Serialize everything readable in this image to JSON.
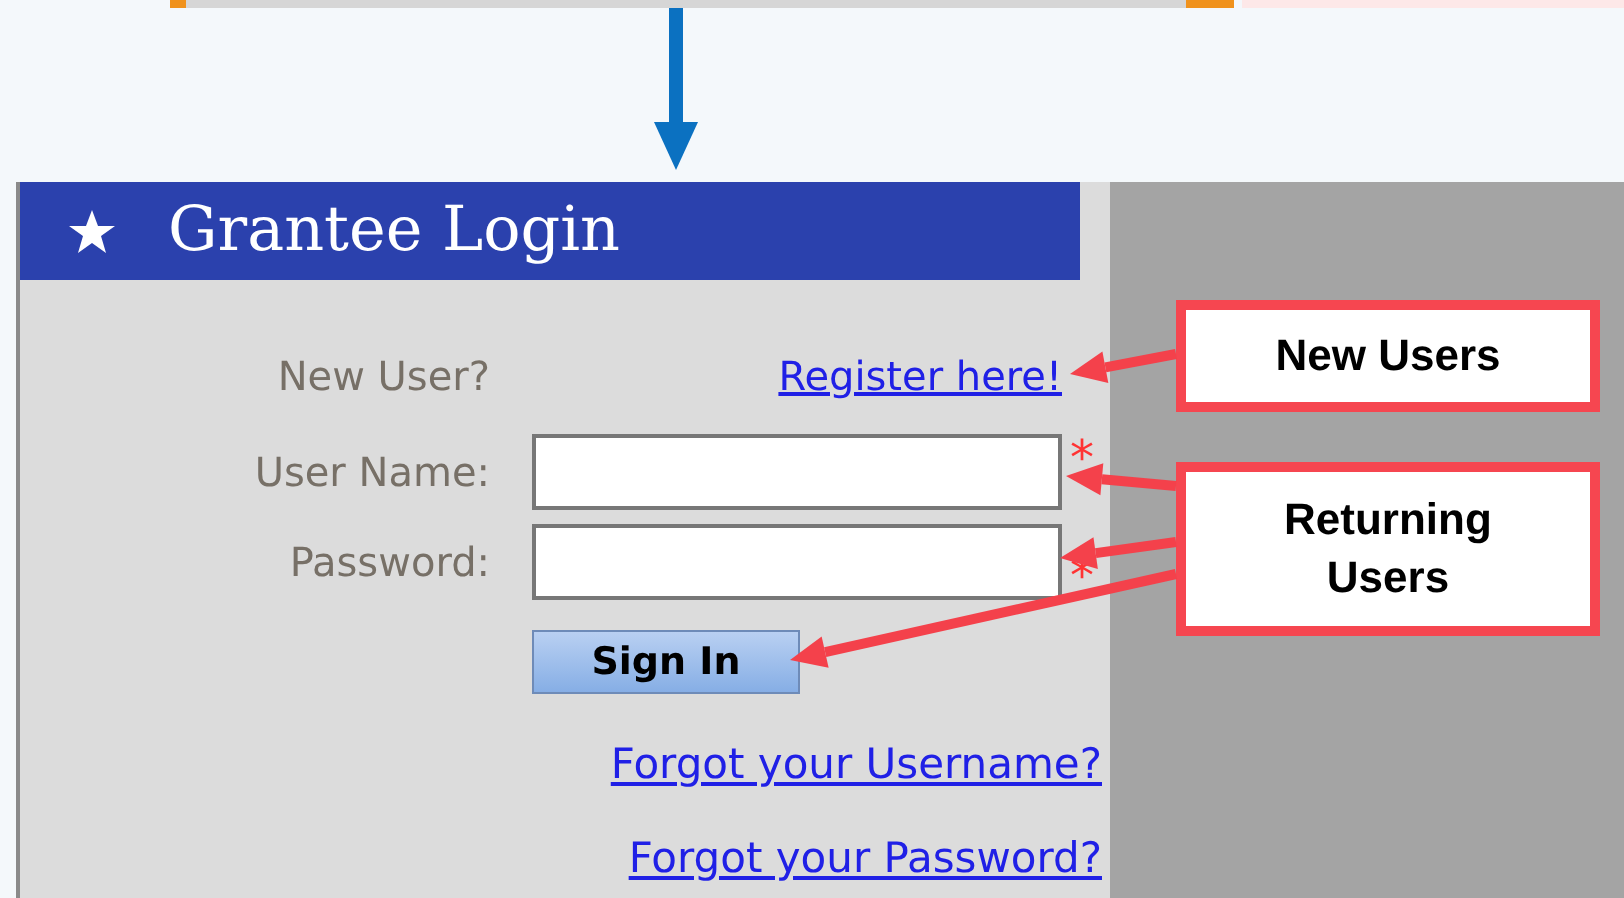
{
  "header": {
    "title": "Grantee Login"
  },
  "form": {
    "new_user_label": "New User?",
    "register_link": "Register here!",
    "fields": [
      {
        "label": "User Name:",
        "required_mark": "*"
      },
      {
        "label": "Password:",
        "required_mark": "*"
      }
    ],
    "sign_in": "Sign In",
    "links": [
      "Forgot your Username?",
      "Forgot your Password?"
    ]
  },
  "callouts": [
    "New Users",
    "Returning Users"
  ]
}
